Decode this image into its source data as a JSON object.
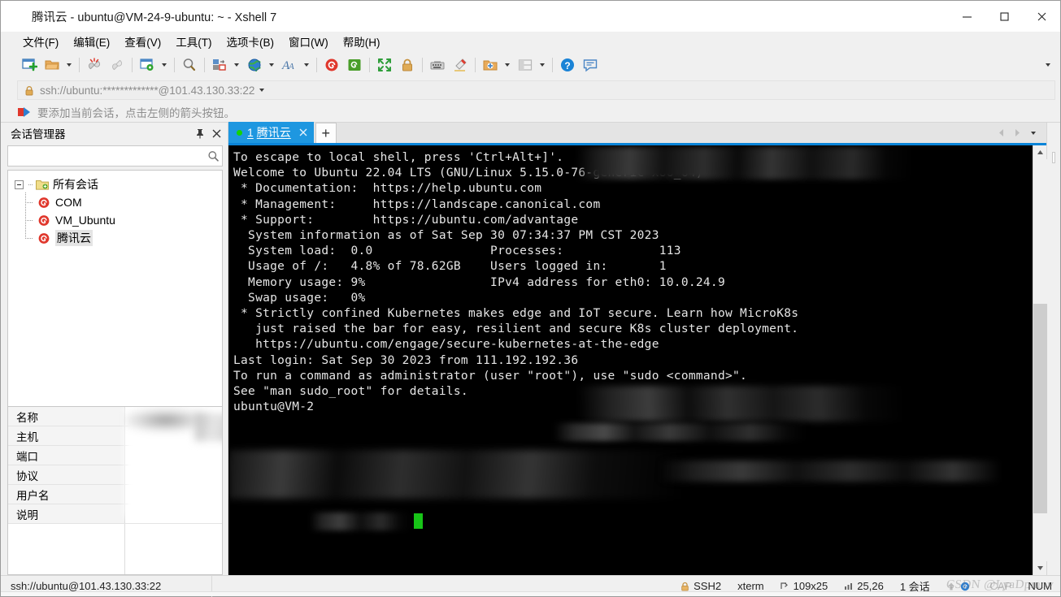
{
  "window": {
    "title": "腾讯云 - ubuntu@VM-24-9-ubuntu: ~ - Xshell 7",
    "app_icon": "xshell-swirl-icon",
    "minimize": "—",
    "maximize": "□",
    "close": "✕"
  },
  "menubar": {
    "items": [
      {
        "label": "文件(F)"
      },
      {
        "label": "编辑(E)"
      },
      {
        "label": "查看(V)"
      },
      {
        "label": "工具(T)"
      },
      {
        "label": "选项卡(B)"
      },
      {
        "label": "窗口(W)"
      },
      {
        "label": "帮助(H)"
      }
    ]
  },
  "toolbar": {
    "items": [
      {
        "name": "new-session-icon",
        "caret": false
      },
      {
        "name": "open-folder-icon",
        "caret": true
      },
      {
        "name": "disconnect-icon",
        "caret": false
      },
      {
        "name": "reconnect-icon",
        "caret": false
      },
      {
        "name": "session-properties-icon",
        "caret": true
      },
      {
        "name": "find-icon",
        "caret": false
      },
      {
        "name": "file-transfer-icon",
        "caret": true
      },
      {
        "name": "globe-icon",
        "caret": true
      },
      {
        "name": "font-icon",
        "caret": true
      },
      {
        "name": "xshell-icon",
        "caret": false
      },
      {
        "name": "xftp-icon",
        "caret": false
      },
      {
        "name": "fullscreen-icon",
        "caret": false
      },
      {
        "name": "lock-icon",
        "caret": false
      },
      {
        "name": "keyboard-icon",
        "caret": false
      },
      {
        "name": "highlight-icon",
        "caret": false
      },
      {
        "name": "add-folder-icon",
        "caret": true
      },
      {
        "name": "layout-icon",
        "caret": true
      },
      {
        "name": "help-icon",
        "caret": false
      },
      {
        "name": "chat-icon",
        "caret": false
      }
    ],
    "overflow_label": "▾"
  },
  "address_bar": {
    "icon": "lock-icon",
    "value": "ssh://ubuntu:*************@101.43.130.33:22",
    "placeholder": "ssh://",
    "dropdown": "▾"
  },
  "hint_bar": {
    "icon": "red-arrow-icon",
    "text": "要添加当前会话，点击左侧的箭头按钮。"
  },
  "session_manager": {
    "title": "会话管理器",
    "pin_label": "⚲",
    "close_label": "✕",
    "search": {
      "value": "",
      "placeholder": "",
      "icon": "search-icon"
    },
    "tree": {
      "root": {
        "label": "所有会话",
        "icon": "folder-icon",
        "expanded": true
      },
      "children": [
        {
          "label": "COM",
          "icon": "session-icon",
          "selected": false
        },
        {
          "label": "VM_Ubuntu",
          "icon": "session-icon",
          "selected": false
        },
        {
          "label": "腾讯云",
          "icon": "session-icon",
          "selected": true
        }
      ]
    },
    "properties": [
      {
        "key": "名称",
        "value": ""
      },
      {
        "key": "主机",
        "value": ""
      },
      {
        "key": "端口",
        "value": ""
      },
      {
        "key": "协议",
        "value": ""
      },
      {
        "key": "用户名",
        "value": ""
      },
      {
        "key": "说明",
        "value": ""
      }
    ]
  },
  "tabs": {
    "items": [
      {
        "index": "1",
        "label": "腾讯云",
        "status": "connected",
        "close": "✕",
        "active": true
      }
    ],
    "new_tab": "+",
    "scroll_left": "◀",
    "scroll_right": "▶",
    "tab_list": "▾"
  },
  "terminal": {
    "lines": [
      "To escape to local shell, press 'Ctrl+Alt+]'.",
      "",
      "Welcome to Ubuntu 22.04 LTS (GNU/Linux 5.15.0-76-generic x86_64)",
      "",
      " * Documentation:  https://help.ubuntu.com",
      " * Management:     https://landscape.canonical.com",
      " * Support:        https://ubuntu.com/advantage",
      "",
      "  System information as of Sat Sep 30 07:34:37 PM CST 2023",
      "",
      "  System load:  0.0                Processes:             113",
      "  Usage of /:   4.8% of 78.62GB    Users logged in:       1",
      "  Memory usage: 9%                 IPv4 address for eth0: 10.0.24.9",
      "  Swap usage:   0%",
      "",
      " * Strictly confined Kubernetes makes edge and IoT secure. Learn how MicroK8s",
      "   just raised the bar for easy, resilient and secure K8s cluster deployment.",
      "",
      "   https://ubuntu.com/engage/secure-kubernetes-at-the-edge",
      "",
      "Last login: Sat Sep 30 2023 from 111.192.192.36",
      "To run a command as administrator (user \"root\"), use \"sudo <command>\".",
      "See \"man sudo_root\" for details.",
      "",
      "ubuntu@VM-24-9-ubuntu:~$ "
    ],
    "prompt_visible": "ubuntu@VM-2",
    "cursor": "block",
    "scrollbar": {
      "up": "▲",
      "down": "▼"
    }
  },
  "statusbar": {
    "connection": "ssh://ubuntu@101.43.130.33:22",
    "protocol": "SSH2",
    "terminal_type": "xterm",
    "size": "109x25",
    "cursor_position": "25,26",
    "sessions": "1 会话",
    "caps": "CAP",
    "num": "NUM",
    "icons": {
      "lock": "lock-icon",
      "size": "size-icon",
      "position": "position-icon",
      "upload": "upload-icon",
      "xftp": "xftp-icon"
    }
  },
  "watermark": {
    "text": "CSDN @LyaDpmov"
  },
  "colors": {
    "accent": "#1e97e0",
    "tab_underline": "#0a84d8",
    "terminal_bg": "#000000",
    "terminal_fg": "#e6e6e6",
    "cursor": "#17c417",
    "chrome": "#f0f0f0"
  }
}
